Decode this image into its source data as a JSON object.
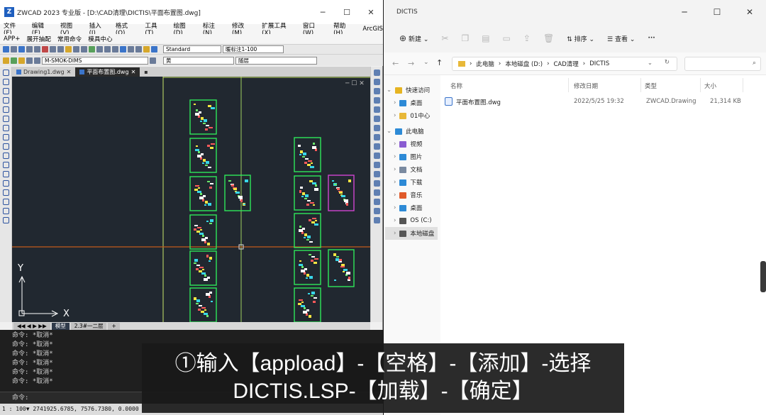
{
  "cad": {
    "title": "ZWCAD 2023 专业版 - [D:\\CAD清理\\DICTIS\\平面布置图.dwg]",
    "logo": "Z",
    "menu_row1": [
      "文件(F)",
      "编辑(E)",
      "视图(V)",
      "插入(I)",
      "格式(O)",
      "工具(T)",
      "绘图(D)",
      "标注(N)",
      "修改(M)",
      "扩展工具(X)",
      "窗口(W)",
      "帮助(H)",
      "ArcGIS"
    ],
    "menu_row2": [
      "APP+",
      "展开抽配",
      "常用命令",
      "模具中心"
    ],
    "style_combo": "Standard",
    "annotation_combo": "暖标注1-100",
    "layer_combo": "M-SMOK-DIMS",
    "color_combo": "黄",
    "linetype_combo": "随层",
    "doc_tabs": [
      "Drawing1.dwg",
      "平面布置图.dwg"
    ],
    "layout_tabs": [
      "模型",
      "2.3#一二层",
      "+"
    ],
    "axis_y": "Y",
    "axis_x": "X",
    "command_history": [
      "命令: *取消*",
      "命令: *取消*",
      "命令: *取消*",
      "命令: *取消*",
      "命令: *取消*",
      "命令: *取消*"
    ],
    "command_prompt": "命令:",
    "status_text": "1 : 100▼  2741925.6785, 7576.7380, 0.0000"
  },
  "explorer": {
    "title": "DICTIS",
    "new_label": "新建",
    "sort_label": "排序",
    "view_label": "查看",
    "more_label": "···",
    "breadcrumb": [
      "此电脑",
      "本地磁盘 (D:)",
      "CAD清理",
      "DICTIS"
    ],
    "columns": [
      "名称",
      "修改日期",
      "类型",
      "大小"
    ],
    "files": [
      {
        "name": "平面布置图.dwg",
        "modified": "2022/5/25 19:32",
        "type": "ZWCAD.Drawing",
        "size": "21,314 KB"
      }
    ],
    "nav": [
      {
        "label": "快速访问",
        "level": 0,
        "icon": "star"
      },
      {
        "label": "桌面",
        "level": 1,
        "icon": "desktop"
      },
      {
        "label": "01中心",
        "level": 1,
        "icon": "folder"
      },
      {
        "label": "此电脑",
        "level": 0,
        "icon": "pc"
      },
      {
        "label": "视频",
        "level": 1,
        "icon": "video"
      },
      {
        "label": "图片",
        "level": 1,
        "icon": "pictures"
      },
      {
        "label": "文档",
        "level": 1,
        "icon": "documents"
      },
      {
        "label": "下载",
        "level": 1,
        "icon": "downloads"
      },
      {
        "label": "音乐",
        "level": 1,
        "icon": "music"
      },
      {
        "label": "桌面",
        "level": 1,
        "icon": "desktop"
      },
      {
        "label": "OS (C:)",
        "level": 1,
        "icon": "drive"
      },
      {
        "label": "本地磁盘",
        "level": 1,
        "icon": "drive"
      }
    ]
  },
  "subtitle": {
    "line1": "①输入【appload】-【空格】-【添加】-选择",
    "line2": "DICTIS.LSP-【加载】-【确定】"
  }
}
